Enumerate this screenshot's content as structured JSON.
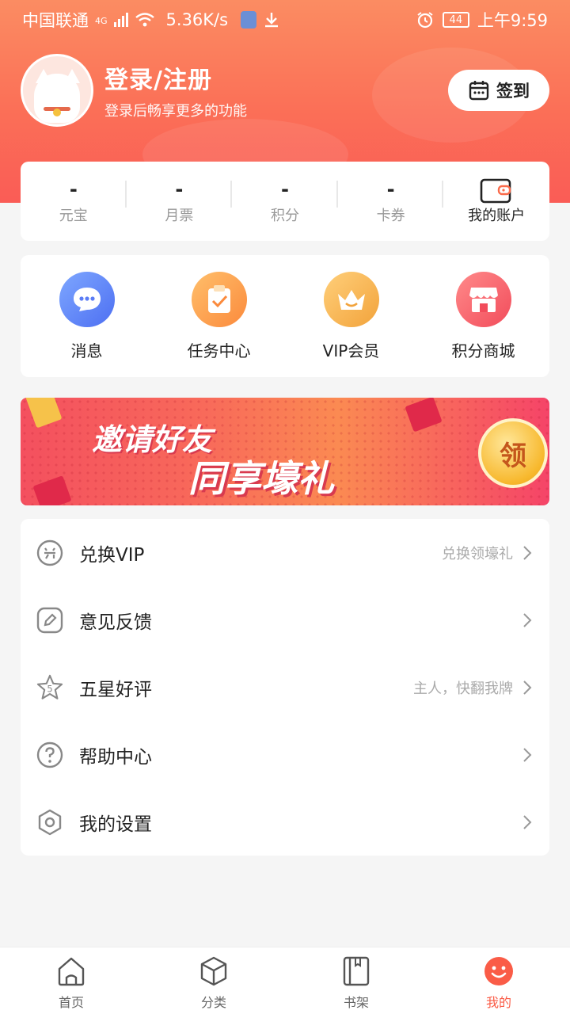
{
  "status_bar": {
    "carrier": "中国联通",
    "network": "4G",
    "speed": "5.36K/s",
    "battery": "44",
    "time": "上午9:59"
  },
  "profile": {
    "title": "登录/注册",
    "subtitle": "登录后畅享更多的功能",
    "checkin_label": "签到"
  },
  "stats": [
    {
      "value": "-",
      "label": "元宝"
    },
    {
      "value": "-",
      "label": "月票"
    },
    {
      "value": "-",
      "label": "积分"
    },
    {
      "value": "-",
      "label": "卡券"
    }
  ],
  "account_label": "我的账户",
  "quick_actions": [
    {
      "label": "消息",
      "icon": "chat-bubble-icon"
    },
    {
      "label": "任务中心",
      "icon": "clipboard-check-icon"
    },
    {
      "label": "VIP会员",
      "icon": "crown-icon"
    },
    {
      "label": "积分商城",
      "icon": "store-icon"
    }
  ],
  "banner": {
    "line1": "邀请好友",
    "line2": "同享壕礼",
    "coin": "领"
  },
  "menu": [
    {
      "label": "兑换VIP",
      "hint": "兑换领壕礼",
      "icon": "exchange-icon"
    },
    {
      "label": "意见反馈",
      "hint": "",
      "icon": "pencil-icon"
    },
    {
      "label": "五星好评",
      "hint": "主人，快翻我牌",
      "icon": "star-icon"
    },
    {
      "label": "帮助中心",
      "hint": "",
      "icon": "question-icon"
    },
    {
      "label": "我的设置",
      "hint": "",
      "icon": "settings-hexagon-icon"
    }
  ],
  "tabs": [
    {
      "label": "首页",
      "icon": "home-icon"
    },
    {
      "label": "分类",
      "icon": "cube-icon"
    },
    {
      "label": "书架",
      "icon": "bookshelf-icon"
    },
    {
      "label": "我的",
      "icon": "smiley-icon"
    }
  ],
  "colors": {
    "accent": "#fa5c47",
    "header_top": "#fb8c62",
    "header_bottom": "#fa5c56"
  }
}
